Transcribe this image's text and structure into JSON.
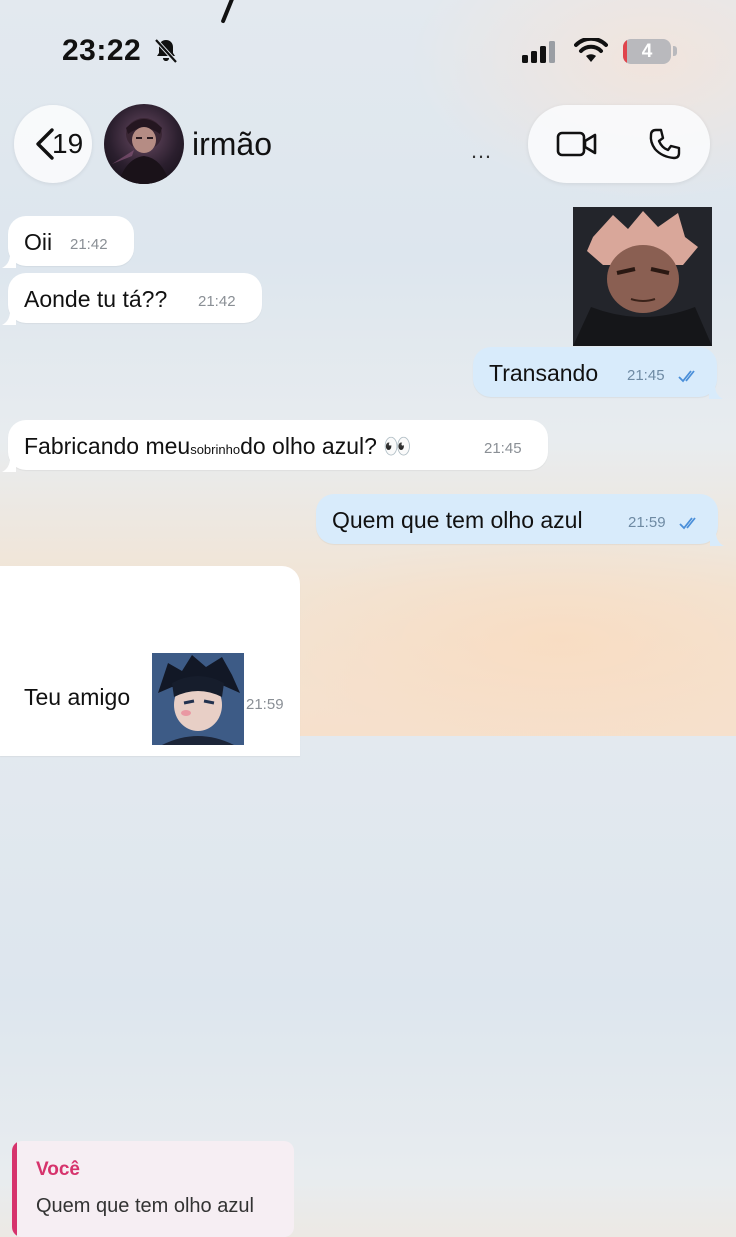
{
  "status_bar": {
    "time": "23:22",
    "battery": "4",
    "battery_level": 0.04
  },
  "header": {
    "back_count": "19",
    "contact_name": "irmão",
    "more": "…"
  },
  "messages": [
    {
      "direction": "in",
      "text": "Oii",
      "time": "21:42"
    },
    {
      "direction": "in",
      "text": "Aonde tu tá??",
      "time": "21:42"
    },
    {
      "direction": "out",
      "text": "Transando",
      "time": "21:45",
      "status": "read"
    },
    {
      "direction": "in",
      "text_before": "Fabricando meu",
      "text_small": "sobrinho",
      "text_after": "do olho azul? 👀",
      "time": "21:45"
    },
    {
      "direction": "out",
      "text": "Quem que tem olho azul",
      "time": "21:59",
      "status": "read"
    },
    {
      "direction": "in",
      "reply_author": "Você",
      "reply_text": "Quem que tem olho azul",
      "text": "Teu amigo",
      "time": "21:59"
    }
  ],
  "colors": {
    "outgoing_bubble": "#d8ebfb",
    "incoming_bubble": "#ffffff",
    "reply_accent": "#d6336c",
    "read_check": "#4a8fd9",
    "battery_low": "#e0444c"
  }
}
